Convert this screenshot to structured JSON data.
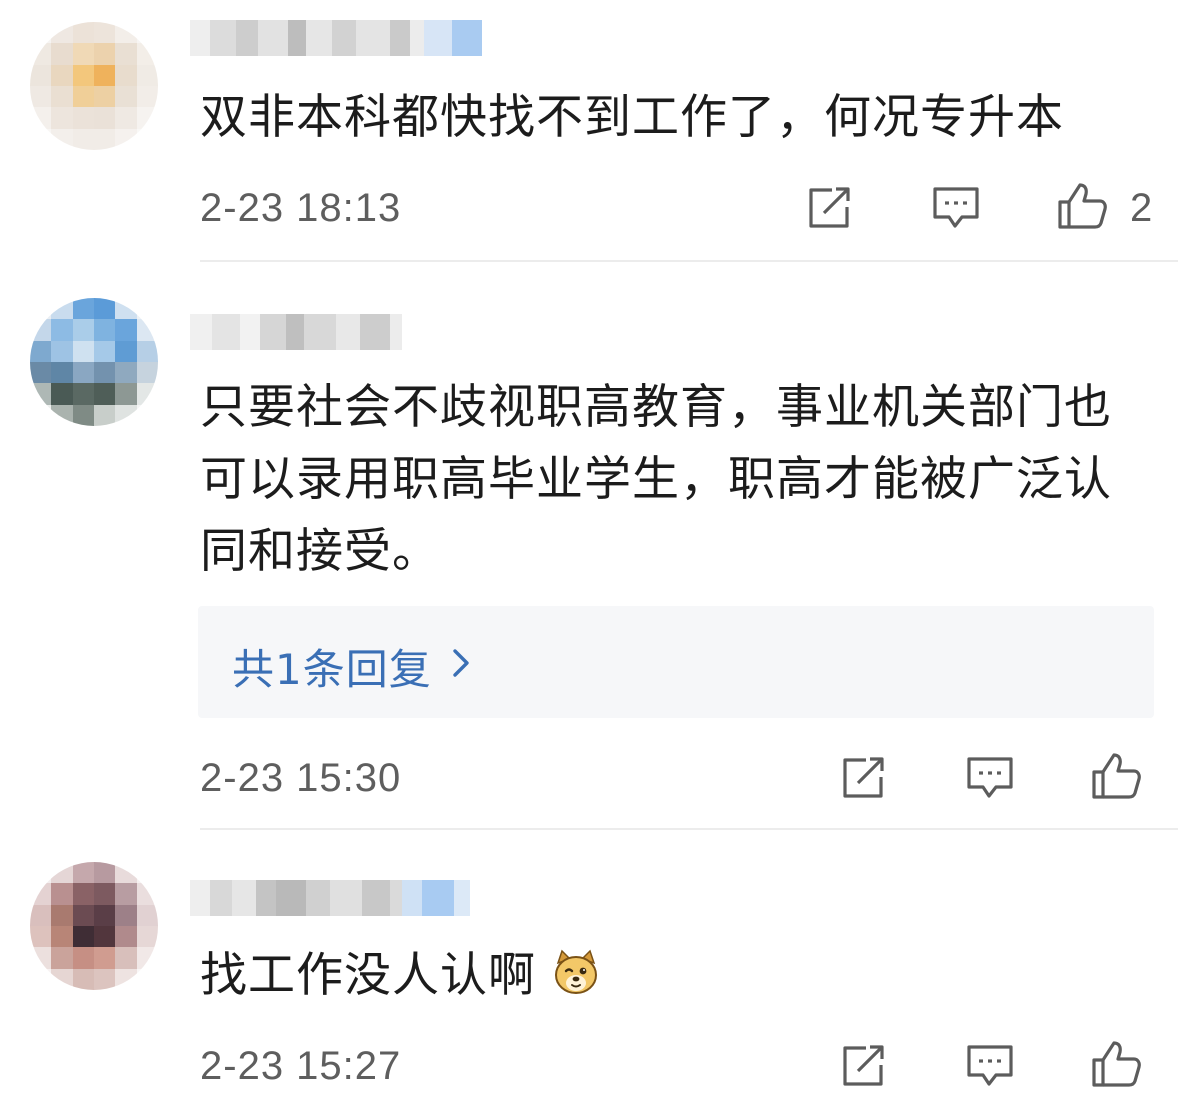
{
  "comments": [
    {
      "content": "双非本科都快找不到工作了，何况专升本",
      "time": "2-23 18:13",
      "likes": "2"
    },
    {
      "content_lines": [
        "只要社会不歧视职高教育，事业机关部门也",
        "可以录用职高毕业学生，职高才能被广泛认",
        "同和接受。"
      ],
      "reply_summary": "共1条回复",
      "time": "2-23 15:30"
    },
    {
      "content": "找工作没人认啊",
      "emoji": "doge-emoji",
      "time": "2-23 15:27"
    }
  ],
  "icons": {
    "share": "share-icon",
    "comment": "comment-icon",
    "like": "thumbs-up-icon",
    "reply_more": "chevron-right-icon"
  },
  "colors": {
    "link": "#3a6fb5",
    "time": "#5e5e5e",
    "text": "#1c1c1c",
    "reply_bg": "#f6f7f9"
  }
}
